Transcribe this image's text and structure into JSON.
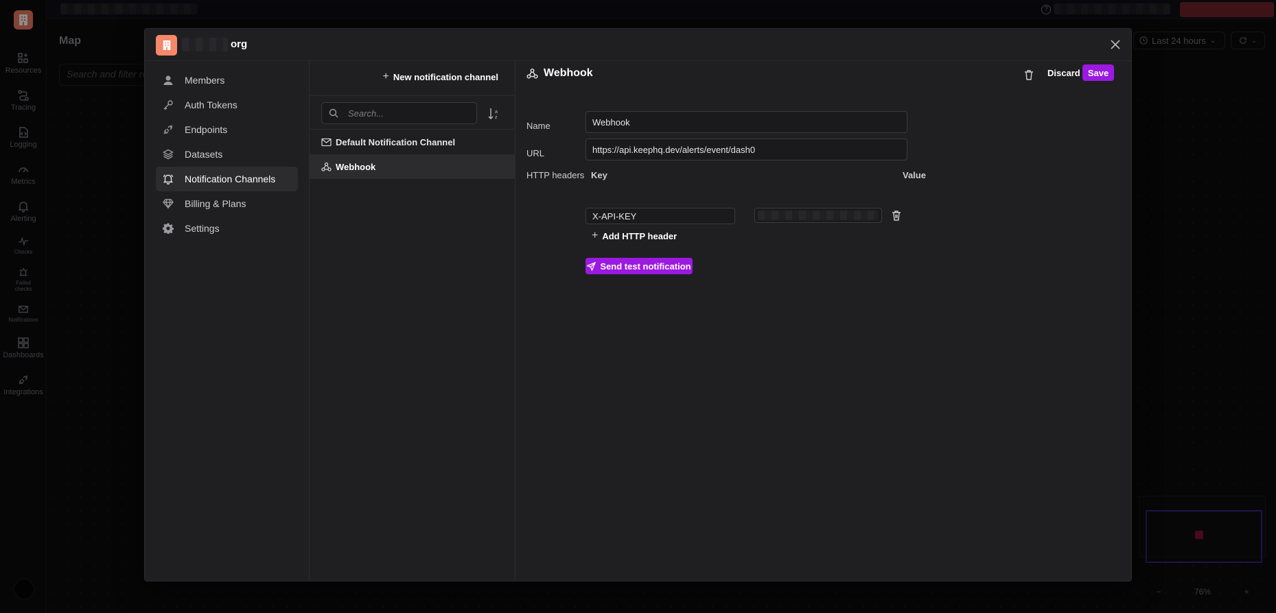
{
  "app": {
    "rail": [
      {
        "id": "resources",
        "label": "Resources",
        "icon": "grid-plus-icon"
      },
      {
        "id": "tracing",
        "label": "Tracing",
        "icon": "route-icon"
      },
      {
        "id": "logging",
        "label": "Logging",
        "icon": "file-code-icon"
      },
      {
        "id": "metrics",
        "label": "Metrics",
        "icon": "gauge-icon"
      },
      {
        "id": "alerting",
        "label": "Alerting",
        "icon": "bell-icon"
      },
      {
        "id": "checks",
        "label": "Checks",
        "icon": "pulse-icon"
      },
      {
        "id": "failed_checks",
        "label": "Failed checks",
        "icon": "siren-icon"
      },
      {
        "id": "notifications",
        "label": "Notifications",
        "icon": "mail-icon"
      },
      {
        "id": "dashboards",
        "label": "Dashboards",
        "icon": "dashboard-icon"
      },
      {
        "id": "integrations",
        "label": "Integrations",
        "icon": "plug-icon"
      }
    ]
  },
  "background": {
    "page_title": "Map",
    "search_placeholder": "Search and filter re",
    "time_range": "Last 24 hours",
    "zoom_minus": "−",
    "zoom_level": "76%",
    "zoom_plus": "+"
  },
  "modal": {
    "org_suffix": "org",
    "nav": [
      {
        "label": "Members",
        "icon": "user-icon",
        "active": false
      },
      {
        "label": "Auth Tokens",
        "icon": "key-icon",
        "active": false
      },
      {
        "label": "Endpoints",
        "icon": "plug-icon",
        "active": false
      },
      {
        "label": "Datasets",
        "icon": "layers-icon",
        "active": false
      },
      {
        "label": "Notification Channels",
        "icon": "bell-icon",
        "active": true
      },
      {
        "label": "Billing & Plans",
        "icon": "gem-icon",
        "active": false
      },
      {
        "label": "Settings",
        "icon": "gear-icon",
        "active": false
      }
    ],
    "channels": {
      "new_label": "New notification channel",
      "search_placeholder": "Search...",
      "items": [
        {
          "label": "Default Notification Channel",
          "icon": "mail-icon",
          "active": false
        },
        {
          "label": "Webhook",
          "icon": "webhook-icon",
          "active": true
        }
      ]
    },
    "detail": {
      "title": "Webhook",
      "discard_label": "Discard",
      "save_label": "Save",
      "name_label": "Name",
      "name_value": "Webhook",
      "url_label": "URL",
      "url_value": "https://api.keephq.dev/alerts/event/dash0",
      "headers_label": "HTTP headers",
      "key_col": "Key",
      "value_col": "Value",
      "header_key": "X-API-KEY",
      "add_header_label": "Add HTTP header",
      "test_label": "Send test notification"
    }
  },
  "colors": {
    "accent": "#9b19e0",
    "org_logo": "#f5876a"
  }
}
